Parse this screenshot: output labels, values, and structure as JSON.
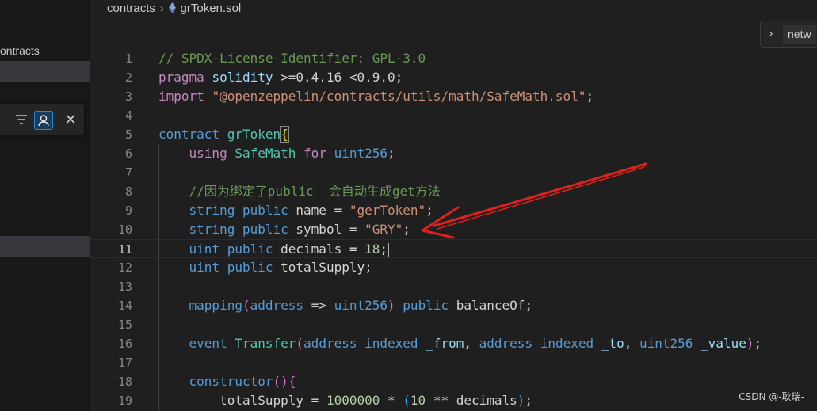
{
  "sidebar": {
    "folder_label": "ontracts"
  },
  "breadcrumb": {
    "folder": "contracts",
    "file": "grToken.sol"
  },
  "sticky_widget": {
    "text": "netw"
  },
  "editor": {
    "current_line": 11,
    "line_numbers": [
      "1",
      "2",
      "3",
      "4",
      "5",
      "6",
      "7",
      "8",
      "9",
      "10",
      "11",
      "12",
      "13",
      "14",
      "15",
      "16",
      "17",
      "18",
      "19"
    ]
  },
  "code": {
    "l1": {
      "comment": "// SPDX-License-Identifier: GPL-3.0"
    },
    "l2": {
      "kw": "pragma",
      "name": "solidity",
      "version": ">=0.4.16 <0.9.0",
      "end": ";"
    },
    "l3": {
      "kw": "import",
      "path": "\"@openzeppelin/contracts/utils/math/SafeMath.sol\"",
      "end": ";"
    },
    "l5": {
      "kw": "contract",
      "name": "grToken",
      "brace": "{"
    },
    "l6": {
      "kw": "using",
      "lib": "SafeMath",
      "for": "for",
      "type": "uint256",
      "end": ";"
    },
    "l8": {
      "comment": "//因为绑定了public  会自动生成get方法"
    },
    "l9": {
      "type": "string",
      "vis": "public",
      "name": "name",
      "eq": " = ",
      "value": "\"gerToken\"",
      "end": ";"
    },
    "l10": {
      "type": "string",
      "vis": "public",
      "name": "symbol",
      "eq": " = ",
      "value": "\"GRY\"",
      "end": ";"
    },
    "l11": {
      "type": "uint",
      "vis": "public",
      "name": "decimals",
      "eq": " = ",
      "value": "18",
      "end": ";"
    },
    "l12": {
      "type": "uint",
      "vis": "public",
      "name": "totalSupply",
      "end": ";"
    },
    "l14": {
      "kw": "mapping",
      "open": "(",
      "k": "address",
      "arrow": " => ",
      "v": "uint256",
      "close": ")",
      "vis": "public",
      "name": "balanceOf",
      "end": ";"
    },
    "l16": {
      "kw": "event",
      "name": "Transfer",
      "open": "(",
      "t1": "address",
      "i1": "indexed",
      "p1": "_from",
      "comma1": ", ",
      "t2": "address",
      "i2": "indexed",
      "p2": "_to",
      "comma2": ", ",
      "t3": "uint256",
      "p3": "_value",
      "close": ")",
      "end": ";"
    },
    "l18": {
      "kw": "constructor",
      "open": "(",
      "close": ")",
      "brace": "{"
    },
    "l19": {
      "lhs": "totalSupply",
      "eq": " = ",
      "num": "1000000",
      "mul": " * ",
      "open": "(",
      "base": "10",
      "pow": " ** ",
      "exp": "decimals",
      "close": ")",
      "end": ";"
    }
  },
  "watermark": {
    "text": "CSDN @-耿瑞-"
  },
  "colors": {
    "annotation_arrow": "#e0201c"
  }
}
